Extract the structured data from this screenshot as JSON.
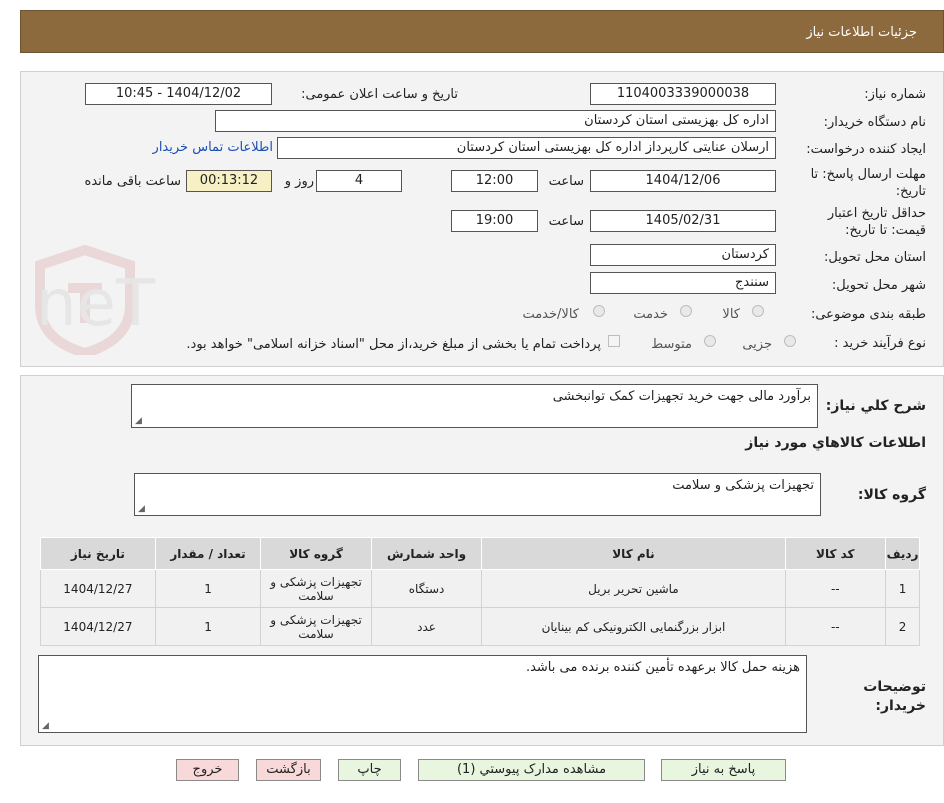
{
  "header": {
    "title": "جزئیات اطلاعات نیاز"
  },
  "labels": {
    "need_number": "شماره نیاز:",
    "announce_datetime": "تاریخ و ساعت اعلان عمومی:",
    "buyer_org": "نام دستگاه خریدار:",
    "requester": "ایجاد کننده درخواست:",
    "reply_deadline": "مهلت ارسال پاسخ: تا تاریخ:",
    "time_word": "ساعت",
    "days_word": "روز و",
    "remaining_word": "ساعت باقی مانده",
    "min_validity": "حداقل تاریخ اعتبار قیمت: تا تاریخ:",
    "delivery_province": "استان محل تحویل:",
    "delivery_city": "شهر محل تحویل:",
    "category": "طبقه بندی موضوعی:",
    "process_type": "نوع فرآیند خرید :",
    "general_desc": "شرح کلي نياز:",
    "goods_info": "اطلاعات کالاهاي مورد نياز",
    "goods_group": "گروه کالا:",
    "buyer_notes": "توضیحات خریدار:"
  },
  "values": {
    "need_number": "1104003339000038",
    "announce_datetime": "1404/12/02 - 10:45",
    "buyer_org": "اداره کل بهزیستی استان کردستان",
    "requester": "ارسلان  عنایتی کارپرداز اداره کل بهزیستی استان کردستان",
    "contact_link": "اطلاعات تماس خریدار",
    "reply_date": "1404/12/06",
    "reply_time": "12:00",
    "days": "4",
    "remaining": "00:13:12",
    "validity_date": "1405/02/31",
    "validity_time": "19:00",
    "province": "کردستان",
    "city": "سنندج",
    "general_desc": "برآورد مالی جهت خرید تجهیزات کمک توانبخشی",
    "goods_group": "تجهیزات پزشکی و سلامت",
    "buyer_notes": "هزینه حمل کالا برعهده تأمین کننده برنده می باشد."
  },
  "category_options": [
    "کالا",
    "خدمت",
    "کالا/خدمت"
  ],
  "process_options": [
    "جزیی",
    "متوسط"
  ],
  "process_note": "پرداخت تمام یا بخشی از مبلغ خرید،از محل \"اسناد خزانه اسلامی\" خواهد بود.",
  "table": {
    "headers": {
      "row": "ردیف",
      "code": "کد کالا",
      "name": "نام کالا",
      "unit": "واحد شمارش",
      "group": "گروه کالا",
      "qty": "تعداد / مقدار",
      "date": "تاریخ نیاز"
    },
    "rows": [
      {
        "row": "1",
        "code": "--",
        "name": "ماشین تحریر بریل",
        "unit": "دستگاه",
        "group": "تجهیزات پزشکی و سلامت",
        "qty": "1",
        "date": "1404/12/27"
      },
      {
        "row": "2",
        "code": "--",
        "name": "ابزار بزرگنمایی الکترونیکی کم بینایان",
        "unit": "عدد",
        "group": "تجهیزات پزشکی و سلامت",
        "qty": "1",
        "date": "1404/12/27"
      }
    ]
  },
  "buttons": {
    "reply": "پاسخ به نیاز",
    "attachments": "مشاهده مدارک پیوستي (1)",
    "print": "چاپ",
    "back": "بازگشت",
    "exit": "خروج"
  },
  "watermark": "AriaTender.neT",
  "colors": {
    "header_bg": "#8c6a3e",
    "link": "#1a4fb5",
    "remaining_bg": "#f6f0c4",
    "button_green": "#e8f6e0",
    "button_pink": "#f8d8d8"
  }
}
